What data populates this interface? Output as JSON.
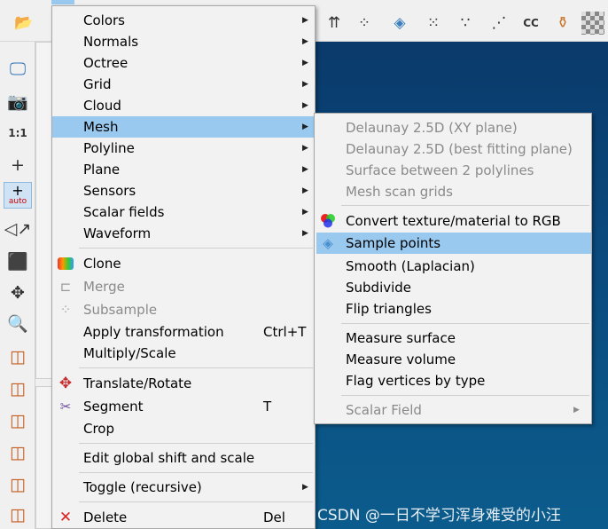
{
  "edit_menu": {
    "items": [
      {
        "label": "Colors",
        "submenu": true
      },
      {
        "label": "Normals",
        "submenu": true
      },
      {
        "label": "Octree",
        "submenu": true
      },
      {
        "label": "Grid",
        "submenu": true
      },
      {
        "label": "Cloud",
        "submenu": true
      },
      {
        "label": "Mesh",
        "submenu": true
      },
      {
        "label": "Polyline",
        "submenu": true
      },
      {
        "label": "Plane",
        "submenu": true
      },
      {
        "label": "Sensors",
        "submenu": true
      },
      {
        "label": "Scalar fields",
        "submenu": true
      },
      {
        "label": "Waveform",
        "submenu": true
      },
      {
        "label": "Clone",
        "icon": "clone-icon"
      },
      {
        "label": "Merge",
        "icon": "merge-icon",
        "disabled": true
      },
      {
        "label": "Subsample",
        "icon": "subsample-icon",
        "disabled": true
      },
      {
        "label": "Apply transformation",
        "shortcut": "Ctrl+T"
      },
      {
        "label": "Multiply/Scale"
      },
      {
        "label": "Translate/Rotate",
        "icon": "translate-rotate-icon"
      },
      {
        "label": "Segment",
        "icon": "segment-icon",
        "shortcut": "T"
      },
      {
        "label": "Crop"
      },
      {
        "label": "Edit global shift and scale"
      },
      {
        "label": "Toggle (recursive)",
        "submenu": true
      },
      {
        "label": "Delete",
        "icon": "delete-icon",
        "shortcut": "Del"
      }
    ]
  },
  "mesh_submenu": {
    "items": [
      {
        "label": "Delaunay 2.5D (XY plane)",
        "disabled": true
      },
      {
        "label": "Delaunay 2.5D (best fitting plane)",
        "disabled": true
      },
      {
        "label": "Surface between 2 polylines",
        "disabled": true
      },
      {
        "label": "Mesh scan grids",
        "disabled": true
      },
      {
        "label": "Convert texture/material to RGB",
        "icon": "rgb-circles-icon"
      },
      {
        "label": "Sample points",
        "icon": "sample-points-icon",
        "highlighted": true
      },
      {
        "label": "Smooth (Laplacian)"
      },
      {
        "label": "Subdivide"
      },
      {
        "label": "Flip triangles"
      },
      {
        "label": "Measure surface"
      },
      {
        "label": "Measure volume"
      },
      {
        "label": "Flag vertices by type"
      },
      {
        "label": "Scalar Field",
        "disabled": true,
        "submenu": true
      }
    ]
  },
  "watermark": "CSDN @一日不学习浑身难受的小汪",
  "colors": {
    "highlight": "#99c9ef",
    "viewport_top": "#0a3a6b",
    "viewport_bottom": "#0b5c8c",
    "disabled": "#8a8a8a"
  }
}
